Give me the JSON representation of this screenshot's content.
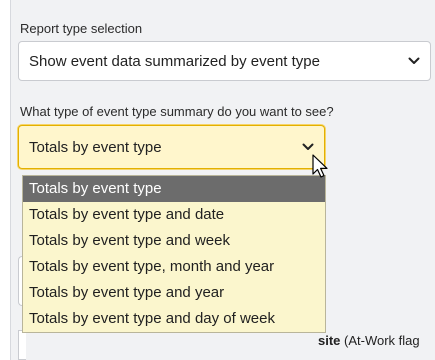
{
  "report_type": {
    "label": "Report type selection",
    "selected": "Show event data summarized by event type"
  },
  "summary_type": {
    "label": "What type of event type summary do you want to see?",
    "selected": "Totals by event type",
    "options": [
      "Totals by event type",
      "Totals by event type and date",
      "Totals by event type and week",
      "Totals by event type, month and year",
      "Totals by event type and year",
      "Totals by event type and day of week"
    ]
  },
  "partially_hidden": {
    "bold_fragment": "site",
    "rest": " (At-Work flag"
  },
  "colors": {
    "focus_background": "#fff6cc",
    "focus_border": "#e3b000",
    "option_highlight": "#6c6c6c",
    "dropdown_background": "#fbf6cd"
  },
  "icons": [
    "chevron-down-icon",
    "mouse-pointer-icon"
  ]
}
